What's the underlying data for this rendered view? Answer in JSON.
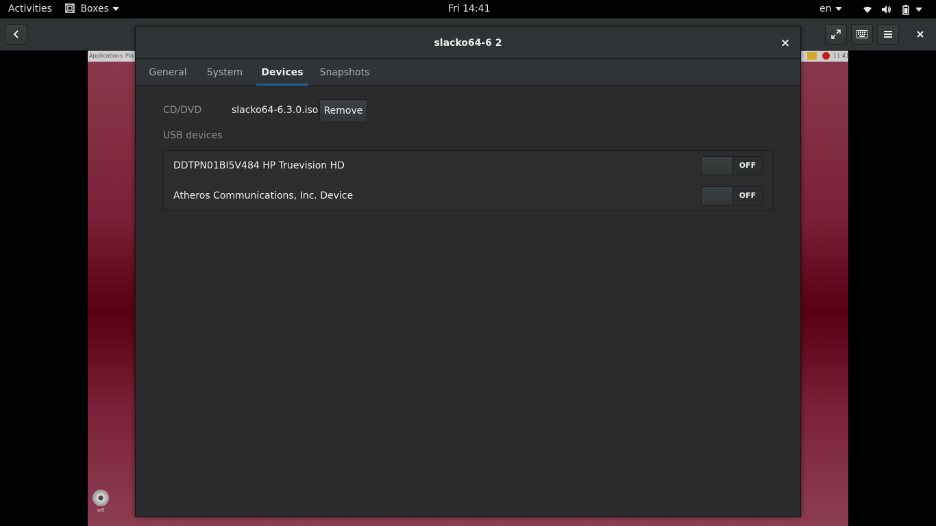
{
  "topbar": {
    "activities": "Activities",
    "app_name": "Boxes",
    "clock": "Fri 14:41",
    "language": "en"
  },
  "headerbar": {
    "back_icon": "back-arrow-icon",
    "fullscreen_icon": "fullscreen-icon",
    "keyboard_icon": "keyboard-icon",
    "menu_icon": "menu-icon",
    "close_icon": "close-icon"
  },
  "guest": {
    "panel_apps": "Applications",
    "panel_places": "Pla",
    "panel_clock": "11:41",
    "cd_label": "sr0"
  },
  "dialog": {
    "title": "slacko64-6 2",
    "close_glyph": "×",
    "tabs": [
      {
        "label": "General",
        "active": false
      },
      {
        "label": "System",
        "active": false
      },
      {
        "label": "Devices",
        "active": true
      },
      {
        "label": "Snapshots",
        "active": false
      }
    ],
    "cd": {
      "label": "CD/DVD",
      "value": "slacko64-6.3.0.iso",
      "remove_label": "Remove"
    },
    "usb": {
      "heading": "USB devices",
      "devices": [
        {
          "name": "DDTPN01BI5V484 HP Truevision HD",
          "state": "OFF"
        },
        {
          "name": "Atheros Communications, Inc. Device",
          "state": "OFF"
        }
      ]
    }
  },
  "colors": {
    "accent": "#215d9c",
    "dialog_bg": "#2b2b2b",
    "guest_bg": "#7a2038"
  }
}
